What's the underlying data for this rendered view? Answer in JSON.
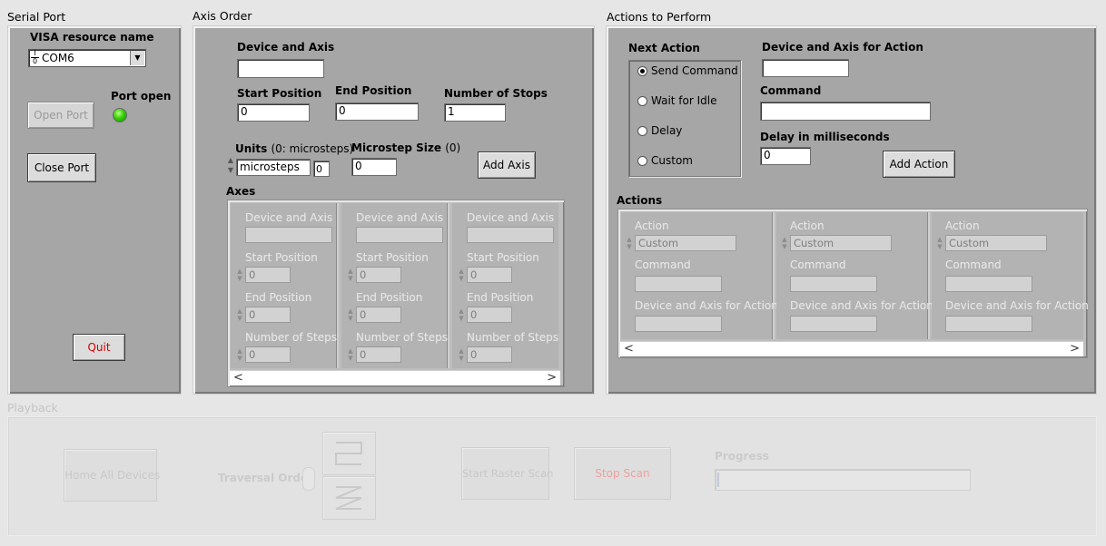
{
  "serial_port": {
    "title": "Serial Port",
    "visa_label": "VISA resource name",
    "visa_value": "COM6",
    "visa_icon_glyph": "I/O",
    "port_open_label": "Port open",
    "open_port": "Open Port",
    "close_port": "Close Port",
    "quit": "Quit",
    "led_color": "#34d000"
  },
  "axis_order": {
    "title": "Axis Order",
    "device_axis_label": "Device and Axis",
    "device_axis_value": "",
    "start_label": "Start Position",
    "start_value": "0",
    "end_label": "End Position",
    "end_value": "0",
    "stops_label": "Number of Stops",
    "stops_value": "1",
    "units_label_bold": "Units",
    "units_label_norm": "(0: microsteps)",
    "units_value": "microsteps",
    "units_index": "0",
    "microstep_label_bold": "Microstep Size",
    "microstep_label_norm": "(0)",
    "microstep_value": "0",
    "add_axis": "Add Axis",
    "axes_label": "Axes",
    "axes": [
      {
        "device_label": "Device and Axis",
        "device_value": "",
        "start_label": "Start Position",
        "start_value": "0",
        "end_label": "End Position",
        "end_value": "0",
        "steps_label": "Number of Steps",
        "steps_value": "0"
      },
      {
        "device_label": "Device and Axis",
        "device_value": "",
        "start_label": "Start Position",
        "start_value": "0",
        "end_label": "End Position",
        "end_value": "0",
        "steps_label": "Number of Steps",
        "steps_value": "0"
      },
      {
        "device_label": "Device and Axis",
        "device_value": "",
        "start_label": "Start Position",
        "start_value": "0",
        "end_label": "End Position",
        "end_value": "0",
        "steps_label": "Number of Steps",
        "steps_value": "0"
      }
    ],
    "scroll_left": "<",
    "scroll_right": ">"
  },
  "actions": {
    "title": "Actions to Perform",
    "next_action_label": "Next Action",
    "options": [
      "Send Command",
      "Wait for Idle",
      "Delay",
      "Custom"
    ],
    "selected": "Send Command",
    "device_axis_label": "Device and Axis for Action",
    "device_axis_value": "",
    "command_label": "Command",
    "command_value": "",
    "delay_label": "Delay in milliseconds",
    "delay_value": "0",
    "add_action": "Add Action",
    "actions_label": "Actions",
    "list": [
      {
        "action_label": "Action",
        "action_value": "Custom",
        "command_label": "Command",
        "command_value": "",
        "device_label": "Device and Axis for Action",
        "device_value": ""
      },
      {
        "action_label": "Action",
        "action_value": "Custom",
        "command_label": "Command",
        "command_value": "",
        "device_label": "Device and Axis for Action",
        "device_value": ""
      },
      {
        "action_label": "Action",
        "action_value": "Custom",
        "command_label": "Command",
        "command_value": "",
        "device_label": "Device and Axis for Action",
        "device_value": ""
      }
    ],
    "scroll_left": "<",
    "scroll_right": ">"
  },
  "playback": {
    "title": "Playback",
    "home_all": "Home All Devices",
    "traversal_label": "Traversal Order",
    "start_raster": "Start Raster Scan",
    "stop_scan": "Stop Scan",
    "progress_label": "Progress"
  },
  "colors": {
    "panel": "#a6a6a6",
    "background": "#e6e6e6",
    "quit_text": "#d40000",
    "stop_text": "#f0a0a0"
  }
}
